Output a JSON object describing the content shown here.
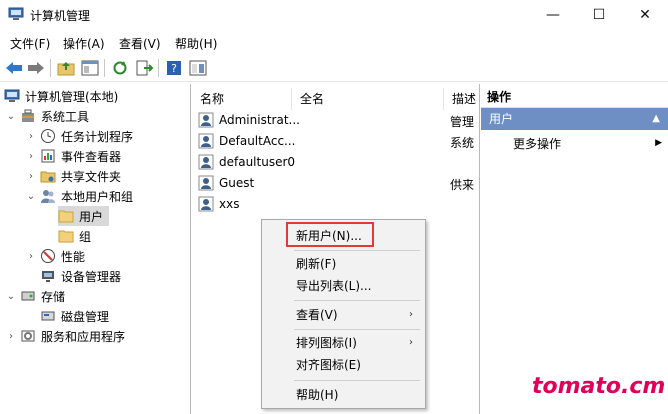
{
  "window": {
    "title": "计算机管理",
    "minimize": "—",
    "maximize": "☐",
    "close": "✕"
  },
  "menu": [
    "文件(F)",
    "操作(A)",
    "查看(V)",
    "帮助(H)"
  ],
  "tree": [
    {
      "label": "计算机管理(本地)",
      "expand": "",
      "icon": "computer-icon"
    },
    {
      "label": "系统工具",
      "expand": "⌄",
      "icon": "tools-icon"
    },
    {
      "label": "任务计划程序",
      "expand": "›",
      "icon": "clock-icon"
    },
    {
      "label": "事件查看器",
      "expand": "›",
      "icon": "event-icon"
    },
    {
      "label": "共享文件夹",
      "expand": "›",
      "icon": "shared-folder-icon"
    },
    {
      "label": "本地用户和组",
      "expand": "⌄",
      "icon": "users-icon"
    },
    {
      "label": "用户",
      "expand": "",
      "icon": "folder-icon"
    },
    {
      "label": "组",
      "expand": "",
      "icon": "folder-icon"
    },
    {
      "label": "性能",
      "expand": "›",
      "icon": "performance-icon"
    },
    {
      "label": "设备管理器",
      "expand": "",
      "icon": "device-icon"
    },
    {
      "label": "存储",
      "expand": "⌄",
      "icon": "storage-icon"
    },
    {
      "label": "磁盘管理",
      "expand": "",
      "icon": "disk-icon"
    },
    {
      "label": "服务和应用程序",
      "expand": "›",
      "icon": "services-icon"
    }
  ],
  "columns": [
    "名称",
    "全名",
    "描述"
  ],
  "users": [
    {
      "name": "Administrat...",
      "desc": "管理"
    },
    {
      "name": "DefaultAcc...",
      "desc": "系统"
    },
    {
      "name": "defaultuser0",
      "desc": ""
    },
    {
      "name": "Guest",
      "desc": "供来"
    },
    {
      "name": "xxs",
      "desc": ""
    }
  ],
  "actions": {
    "header": "操作",
    "section": "用户",
    "more": "更多操作",
    "collapse_arrow": "▲",
    "more_arrow": "▶"
  },
  "context_menu": [
    {
      "label": "新用户(N)...",
      "submenu": false
    },
    {
      "label": "刷新(F)",
      "submenu": false
    },
    {
      "label": "导出列表(L)...",
      "submenu": false
    },
    {
      "label": "查看(V)",
      "submenu": true
    },
    {
      "label": "排列图标(I)",
      "submenu": true
    },
    {
      "label": "对齐图标(E)",
      "submenu": false
    },
    {
      "label": "帮助(H)",
      "submenu": false
    }
  ],
  "submenu_arrow": "›",
  "watermark": "tomato.cm",
  "colors": {
    "highlight_red": "#e23a3a",
    "section_blue": "#6d8fc4",
    "watermark": "#e0005a"
  }
}
